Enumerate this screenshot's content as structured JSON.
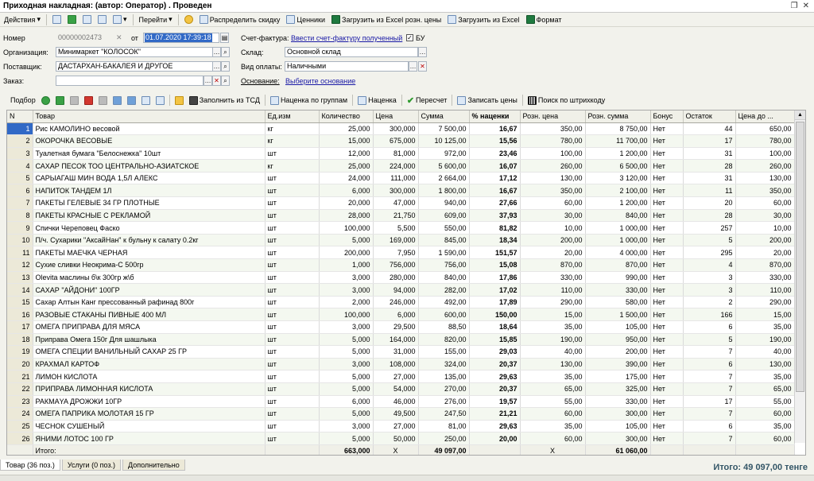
{
  "window": {
    "title": "Приходная накладная: (автор: Оператор) . Проведен"
  },
  "toolbar": {
    "actions": "Действия",
    "goto": "Перейти",
    "distribute_discount": "Распределить скидку",
    "price_tags": "Ценники",
    "load_excel_retail": "Загрузить из Excel розн. цены",
    "load_excel": "Загрузить из Excel",
    "format": "Формат"
  },
  "form": {
    "number_label": "Номер",
    "number_value": "00000002473",
    "from_label": "от",
    "date_value": "01.07.2020 17:39:18",
    "invoice_label": "Счет-фактура:",
    "invoice_link": "Ввести счет-фактуру полученный",
    "bu_label": "БУ",
    "org_label": "Организация:",
    "org_value": "Минимаркет \"КОЛОСОК\"",
    "warehouse_label": "Склад:",
    "warehouse_value": "Основной склад",
    "supplier_label": "Поставщик:",
    "supplier_value": "ДАСТАРХАН-БАКАЛЕЯ И ДРУГОЕ",
    "payment_label": "Вид оплаты:",
    "payment_value": "Наличными",
    "order_label": "Заказ:",
    "order_value": "",
    "basis_label": "Основание:",
    "basis_link": "Выберите основание"
  },
  "toolbar2": {
    "select": "Подбор",
    "fill_tsd": "Заполнить из ТСД",
    "markup_groups": "Наценка по группам",
    "markup": "Наценка",
    "recalc": "Пересчет",
    "write_prices": "Записать цены",
    "barcode_search": "Поиск по штрихкоду"
  },
  "grid": {
    "columns": [
      "N",
      "Товар",
      "Ед.изм",
      "Количество",
      "Цена",
      "Сумма",
      "% наценки",
      "Розн. цена",
      "Розн. сумма",
      "Бонус",
      "Остаток",
      "Цена до ..."
    ],
    "rows": [
      [
        "1",
        "Рис КАМОЛИНО весовой",
        "кг",
        "25,000",
        "300,000",
        "7 500,00",
        "16,67",
        "350,00",
        "8 750,00",
        "Нет",
        "44",
        "650,00"
      ],
      [
        "2",
        "ОКОРОЧКА ВЕСОВЫЕ",
        "кг",
        "15,000",
        "675,000",
        "10 125,00",
        "15,56",
        "780,00",
        "11 700,00",
        "Нет",
        "17",
        "780,00"
      ],
      [
        "3",
        "Туалетная бумага \"Белоснежка\" 10шт",
        "шт",
        "12,000",
        "81,000",
        "972,00",
        "23,46",
        "100,00",
        "1 200,00",
        "Нет",
        "31",
        "100,00"
      ],
      [
        "4",
        "САХАР ПЕСОК ТОО ЦЕНТРАЛЬНО-АЗИАТСКОЕ",
        "кг",
        "25,000",
        "224,000",
        "5 600,00",
        "16,07",
        "260,00",
        "6 500,00",
        "Нет",
        "28",
        "260,00"
      ],
      [
        "5",
        "САРЫАГАШ МИН ВОДА 1,5Л АЛЕКС",
        "шт",
        "24,000",
        "111,000",
        "2 664,00",
        "17,12",
        "130,00",
        "3 120,00",
        "Нет",
        "31",
        "130,00"
      ],
      [
        "6",
        "НАПИТОК ТАНДЕМ 1Л",
        "шт",
        "6,000",
        "300,000",
        "1 800,00",
        "16,67",
        "350,00",
        "2 100,00",
        "Нет",
        "11",
        "350,00"
      ],
      [
        "7",
        "ПАКЕТЫ ГЕЛЕВЫЕ 34 ГР ПЛОТНЫЕ",
        "шт",
        "20,000",
        "47,000",
        "940,00",
        "27,66",
        "60,00",
        "1 200,00",
        "Нет",
        "20",
        "60,00"
      ],
      [
        "8",
        "ПАКЕТЫ КРАСНЫЕ С РЕКЛАМОЙ",
        "шт",
        "28,000",
        "21,750",
        "609,00",
        "37,93",
        "30,00",
        "840,00",
        "Нет",
        "28",
        "30,00"
      ],
      [
        "9",
        "Спички Череповец Фаско",
        "шт",
        "100,000",
        "5,500",
        "550,00",
        "81,82",
        "10,00",
        "1 000,00",
        "Нет",
        "257",
        "10,00"
      ],
      [
        "10",
        "П/ч. Сухарики \"АксайНан\" к бульну к салату 0.2кг",
        "шт",
        "5,000",
        "169,000",
        "845,00",
        "18,34",
        "200,00",
        "1 000,00",
        "Нет",
        "5",
        "200,00"
      ],
      [
        "11",
        "ПАКЕТЫ МАЕЧКА ЧЕРНАЯ",
        "шт",
        "200,000",
        "7,950",
        "1 590,00",
        "151,57",
        "20,00",
        "4 000,00",
        "Нет",
        "295",
        "20,00"
      ],
      [
        "12",
        "Сухие сливки Неокрима-С 500гр",
        "шт",
        "1,000",
        "756,000",
        "756,00",
        "15,08",
        "870,00",
        "870,00",
        "Нет",
        "4",
        "870,00"
      ],
      [
        "13",
        "Olevita маслины б\\к 300гр ж\\б",
        "шт",
        "3,000",
        "280,000",
        "840,00",
        "17,86",
        "330,00",
        "990,00",
        "Нет",
        "3",
        "330,00"
      ],
      [
        "14",
        "САХАР \"АЙДОНИ\" 100ГР",
        "шт",
        "3,000",
        "94,000",
        "282,00",
        "17,02",
        "110,00",
        "330,00",
        "Нет",
        "3",
        "110,00"
      ],
      [
        "15",
        "Сахар Алтын Канг прессованный рафинад 800г",
        "шт",
        "2,000",
        "246,000",
        "492,00",
        "17,89",
        "290,00",
        "580,00",
        "Нет",
        "2",
        "290,00"
      ],
      [
        "16",
        "РАЗОВЫЕ СТАКАНЫ ПИВНЫЕ 400 МЛ",
        "шт",
        "100,000",
        "6,000",
        "600,00",
        "150,00",
        "15,00",
        "1 500,00",
        "Нет",
        "166",
        "15,00"
      ],
      [
        "17",
        "ОМЕГА ПРИПРАВА ДЛЯ МЯСА",
        "шт",
        "3,000",
        "29,500",
        "88,50",
        "18,64",
        "35,00",
        "105,00",
        "Нет",
        "6",
        "35,00"
      ],
      [
        "18",
        "Приправа Омега 150г Для шашлыка",
        "шт",
        "5,000",
        "164,000",
        "820,00",
        "15,85",
        "190,00",
        "950,00",
        "Нет",
        "5",
        "190,00"
      ],
      [
        "19",
        "ОМЕГА СПЕЦИИ ВАНИЛЬНЫЙ САХАР 25 ГР",
        "шт",
        "5,000",
        "31,000",
        "155,00",
        "29,03",
        "40,00",
        "200,00",
        "Нет",
        "7",
        "40,00"
      ],
      [
        "20",
        "КРАХМАЛ КАРТОФ",
        "шт",
        "3,000",
        "108,000",
        "324,00",
        "20,37",
        "130,00",
        "390,00",
        "Нет",
        "6",
        "130,00"
      ],
      [
        "21",
        "ЛИМОН КИСЛОТА",
        "шт",
        "5,000",
        "27,000",
        "135,00",
        "29,63",
        "35,00",
        "175,00",
        "Нет",
        "7",
        "35,00"
      ],
      [
        "22",
        "ПРИПРАВА ЛИМОННАЯ КИСЛОТА",
        "шт",
        "5,000",
        "54,000",
        "270,00",
        "20,37",
        "65,00",
        "325,00",
        "Нет",
        "7",
        "65,00"
      ],
      [
        "23",
        "РАКМАYA ДРОЖЖИ 10ГР",
        "шт",
        "6,000",
        "46,000",
        "276,00",
        "19,57",
        "55,00",
        "330,00",
        "Нет",
        "17",
        "55,00"
      ],
      [
        "24",
        "ОМЕГА ПАПРИКА МОЛОТАЯ 15 ГР",
        "шт",
        "5,000",
        "49,500",
        "247,50",
        "21,21",
        "60,00",
        "300,00",
        "Нет",
        "7",
        "60,00"
      ],
      [
        "25",
        "ЧЕСНОК СУШЕНЫЙ",
        "шт",
        "3,000",
        "27,000",
        "81,00",
        "29,63",
        "35,00",
        "105,00",
        "Нет",
        "6",
        "35,00"
      ],
      [
        "26",
        "ЯНИМИ ЛОТОС 100 ГР",
        "шт",
        "5,000",
        "50,000",
        "250,00",
        "20,00",
        "60,00",
        "300,00",
        "Нет",
        "7",
        "60,00"
      ]
    ],
    "footer": {
      "label": "Итого:",
      "quantity": "663,000",
      "price": "X",
      "sum": "49 097,00",
      "retail_price": "X",
      "retail_sum": "61 060,00"
    }
  },
  "tabs": [
    "Товар (36 поз.)",
    "Услуги (0 поз.)",
    "Дополнительно"
  ],
  "total": "Итого: 49 097,00 тенге"
}
